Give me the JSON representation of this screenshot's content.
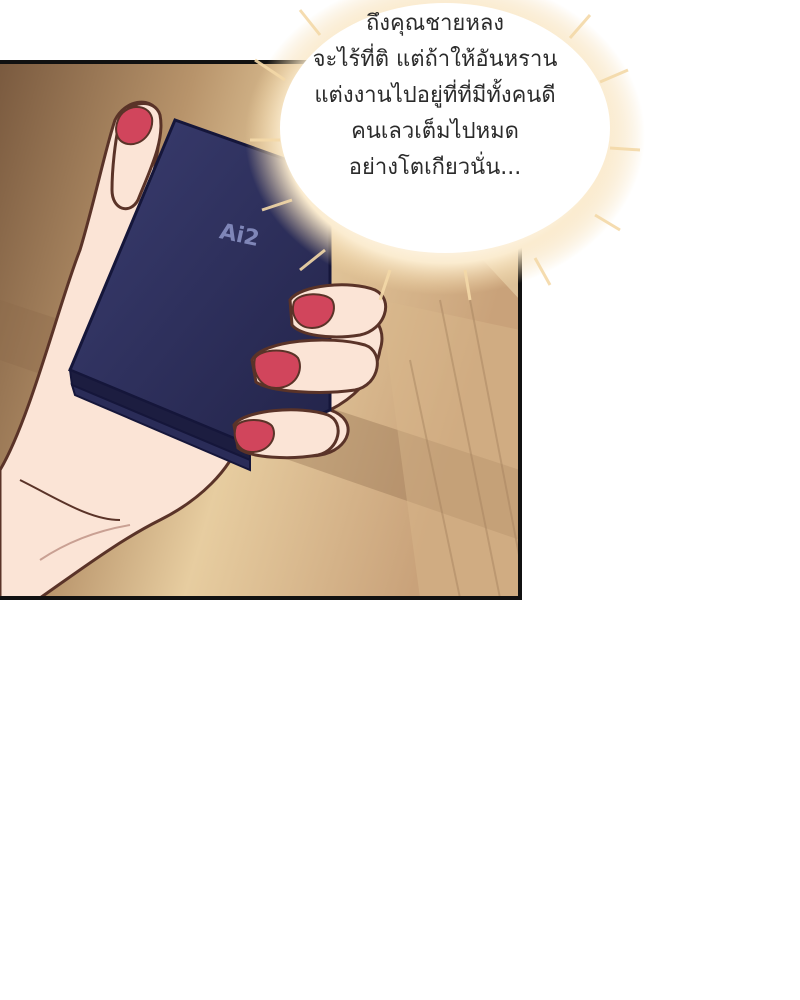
{
  "speech_bubble": {
    "lines": [
      "ถึงคุณชายหลง",
      "จะไร้ที่ติ แต่ถ้าให้อันหราน",
      "แต่งงานไปอยู่ที่ที่มีทั้งคนดี",
      "คนเลวเต็มไปหมด",
      "อย่างโตเกียวนั่น..."
    ]
  },
  "box_logo": "Ai2",
  "colors": {
    "box": "#2d2f5c",
    "nails": "#d1455c",
    "skin": "#fbe4d6",
    "background_wood": "#a87c55",
    "bubble_glow": "#f4d9a8"
  }
}
